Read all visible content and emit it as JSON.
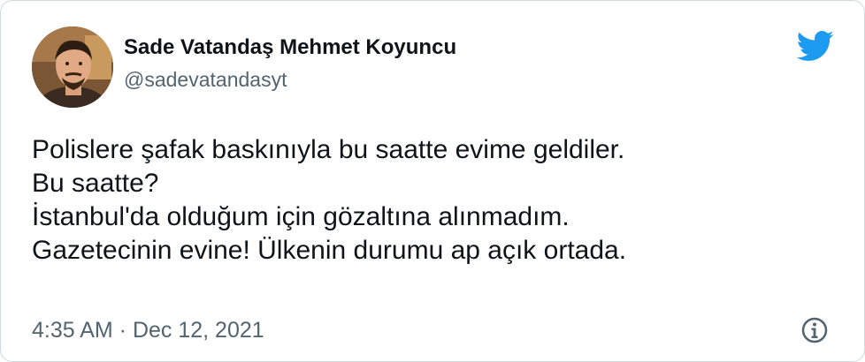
{
  "author": {
    "display_name": "Sade Vatandaş Mehmet Koyuncu",
    "handle": "@sadevatandasyt",
    "avatar_icon": "profile-photo"
  },
  "brand": {
    "icon": "twitter-bird-icon",
    "color": "#1d9bf0"
  },
  "tweet": {
    "lines": [
      "Polislere şafak baskınıyla bu saatte evime geldiler.",
      "Bu saatte?",
      "İstanbul'da olduğum için gözaltına alınmadım.",
      "Gazetecinin evine! Ülkenin durumu ap açık ortada."
    ]
  },
  "meta": {
    "time": "4:35 AM",
    "separator": " · ",
    "date": "Dec 12, 2021",
    "info_icon": "info-icon"
  },
  "colors": {
    "text": "#0f1419",
    "secondary": "#536471",
    "border": "#cfd9de"
  }
}
